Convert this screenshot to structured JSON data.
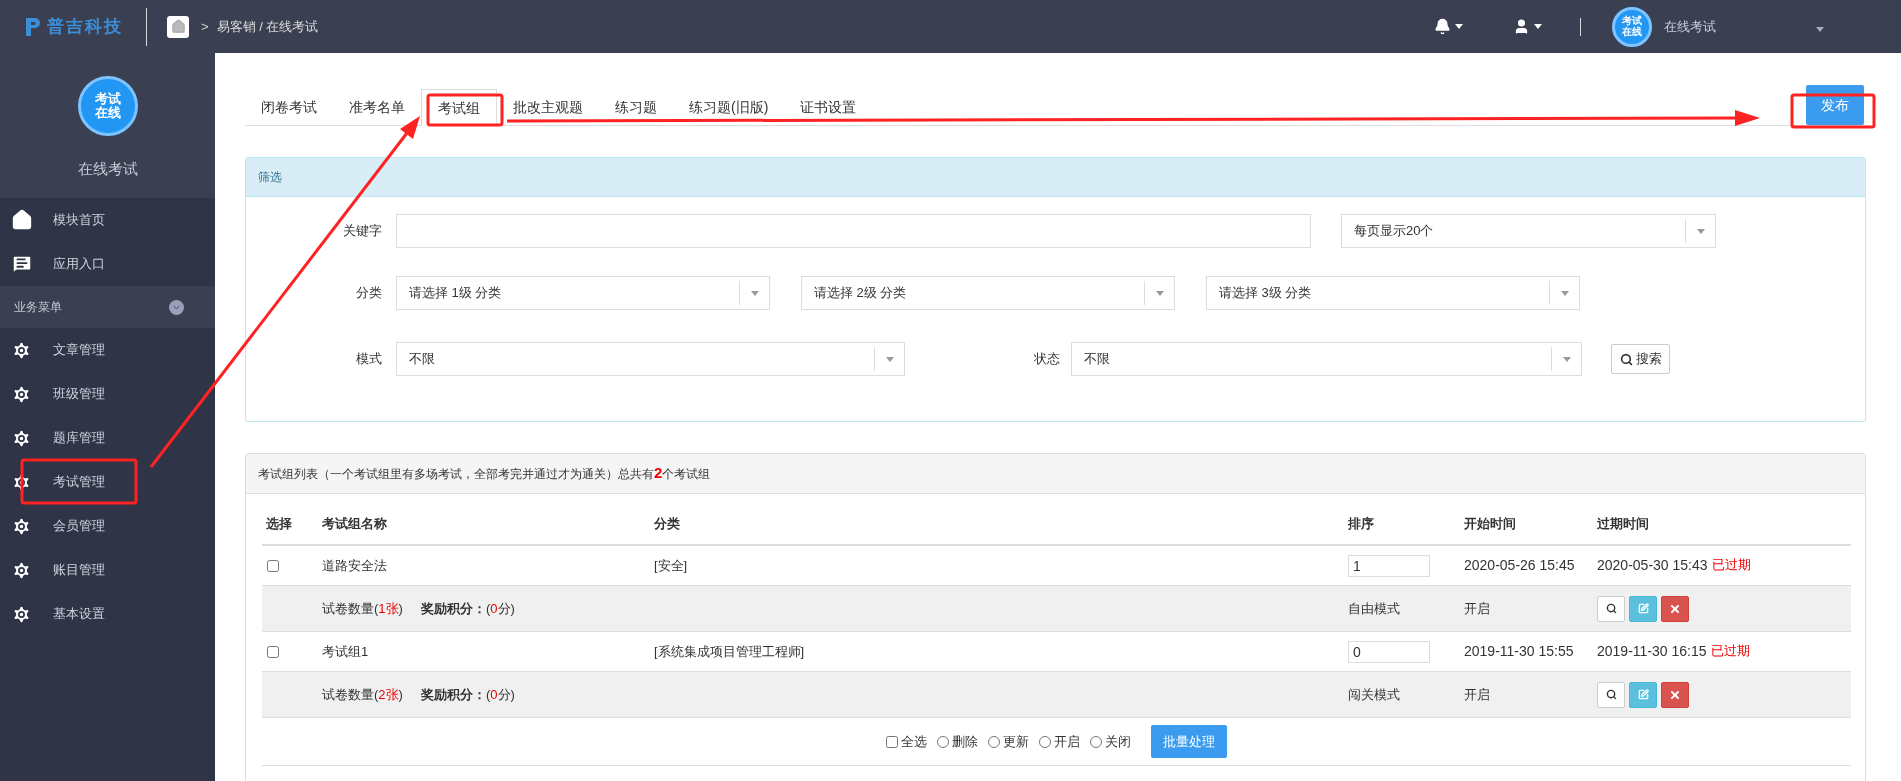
{
  "header": {
    "brand": "普吉科技",
    "breadcrumb_separator": ">",
    "breadcrumb": "易客销 / 在线考试",
    "avatar_text": [
      "考试",
      "在线"
    ],
    "user_name": "在线考试"
  },
  "sidebar": {
    "logo_text": [
      "考试",
      "在线"
    ],
    "title": "在线考试",
    "top_items": [
      {
        "label": "模块首页",
        "kind": "home"
      },
      {
        "label": "应用入口",
        "kind": "chat"
      }
    ],
    "section": {
      "label": "业务菜单",
      "expanded": true
    },
    "items": [
      {
        "label": "文章管理",
        "kind": "gear"
      },
      {
        "label": "班级管理",
        "kind": "gear"
      },
      {
        "label": "题库管理",
        "kind": "gear"
      },
      {
        "label": "考试管理",
        "kind": "gear"
      },
      {
        "label": "会员管理",
        "kind": "gear"
      },
      {
        "label": "账目管理",
        "kind": "gear"
      },
      {
        "label": "基本设置",
        "kind": "gear"
      }
    ]
  },
  "tabs": [
    {
      "label": "闭卷考试",
      "selected": false
    },
    {
      "label": "准考名单",
      "selected": false
    },
    {
      "label": "考试组",
      "selected": true
    },
    {
      "label": "批改主观题",
      "selected": false
    },
    {
      "label": "练习题",
      "selected": false
    },
    {
      "label": "练习题(旧版)",
      "selected": false
    },
    {
      "label": "证书设置",
      "selected": false
    }
  ],
  "publish_button": "发布",
  "filter": {
    "title": "筛选",
    "keyword_label": "关键字",
    "page_size": "每页显示20个",
    "category_label": "分类",
    "categories": [
      "请选择 1级 分类",
      "请选择 2级 分类",
      "请选择 3级 分类"
    ],
    "mode_label": "模式",
    "mode": "不限",
    "status_label": "状态",
    "status": "不限",
    "search_button": "搜索"
  },
  "table": {
    "title": "考试组列表（一个考试组里有多场考试，全部考完并通过才为通关）总共有**2**个考试组",
    "columns": [
      "选择",
      "考试组名称",
      "分类",
      "排序",
      "开始时间",
      "过期时间"
    ],
    "rows": [
      {
        "checked": false,
        "name": "道路安全法",
        "category": "[安全]",
        "order": "1",
        "start": "2020-05-26 15:45",
        "expire": "2020-05-30 15:43",
        "expired_label": "已过期",
        "papers": {
          "prefix": "试卷数量(",
          "count": "1张",
          "suffix": ")"
        },
        "reward": {
          "label": "奖励积分：",
          "prefix": "(",
          "value": "0",
          "suffix": "分)"
        },
        "mode": "自由模式",
        "status": "开启"
      },
      {
        "checked": false,
        "name": "考试组1",
        "category": "[系统集成项目管理工程师]",
        "order": "0",
        "start": "2019-11-30 15:55",
        "expire": "2019-11-30 16:15",
        "expired_label": "已过期",
        "papers": {
          "prefix": "试卷数量(",
          "count": "2张",
          "suffix": ")"
        },
        "reward": {
          "label": "奖励积分：",
          "prefix": "(",
          "value": "0",
          "suffix": "分)"
        },
        "mode": "闯关模式",
        "status": "开启"
      }
    ],
    "batch": {
      "select_all": {
        "label": "全选",
        "checked": false
      },
      "actions": [
        {
          "label": "删除",
          "selected": false
        },
        {
          "label": "更新",
          "selected": false
        },
        {
          "label": "开启",
          "selected": false
        },
        {
          "label": "关闭",
          "selected": false
        }
      ],
      "button": "批量处理"
    }
  }
}
